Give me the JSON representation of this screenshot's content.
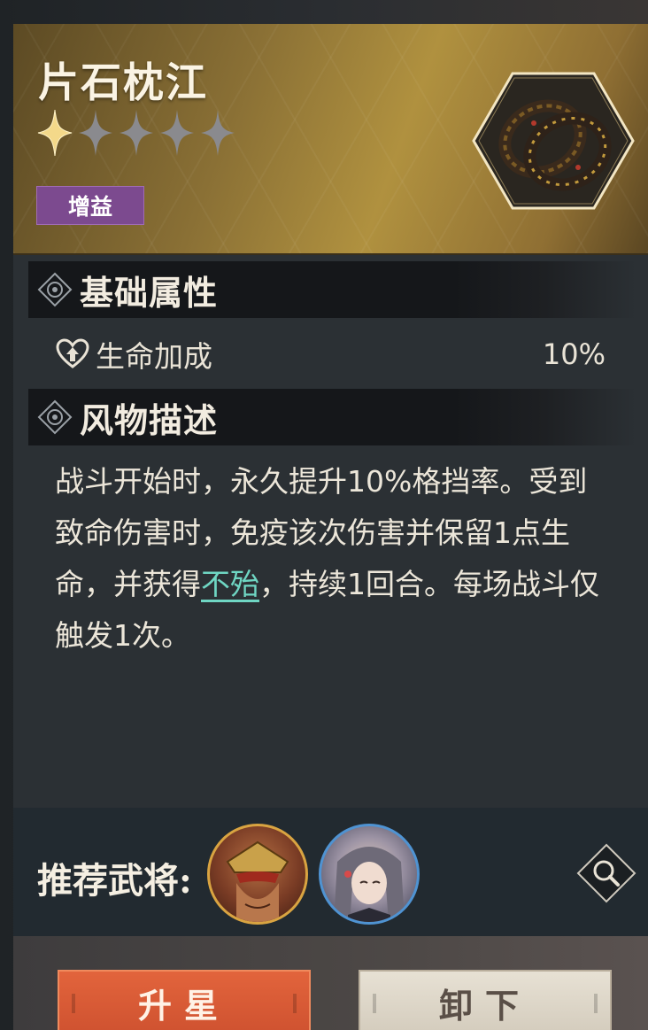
{
  "relic": {
    "name": "片石枕江",
    "stars_filled": 1,
    "stars_total": 5,
    "tag": "增益",
    "icon": "twin-bangle-icon"
  },
  "sections": {
    "basic_title": "基础属性",
    "desc_title": "风物描述"
  },
  "attribute": {
    "icon": "heart-up-icon",
    "name": "生命加成",
    "value": "10%"
  },
  "description": {
    "part1": "战斗开始时，永久提升10%格挡率。受到致命伤害时，免疫该次伤害并保留1点生命，并获得",
    "keyword": "不殆",
    "part2": "，持续1回合。每场战斗仅触发1次。"
  },
  "recommend": {
    "label": "推荐武将:",
    "heroes": [
      "hero-avatar-red-mask",
      "hero-avatar-silver-hair"
    ]
  },
  "buttons": {
    "star_up": "升星",
    "unequip": "卸下"
  },
  "colors": {
    "header_gold": "#b0913f",
    "tag_purple": "#7c4a8f",
    "keyword_teal": "#6fd6c3",
    "btn_orange": "#e2643c"
  }
}
